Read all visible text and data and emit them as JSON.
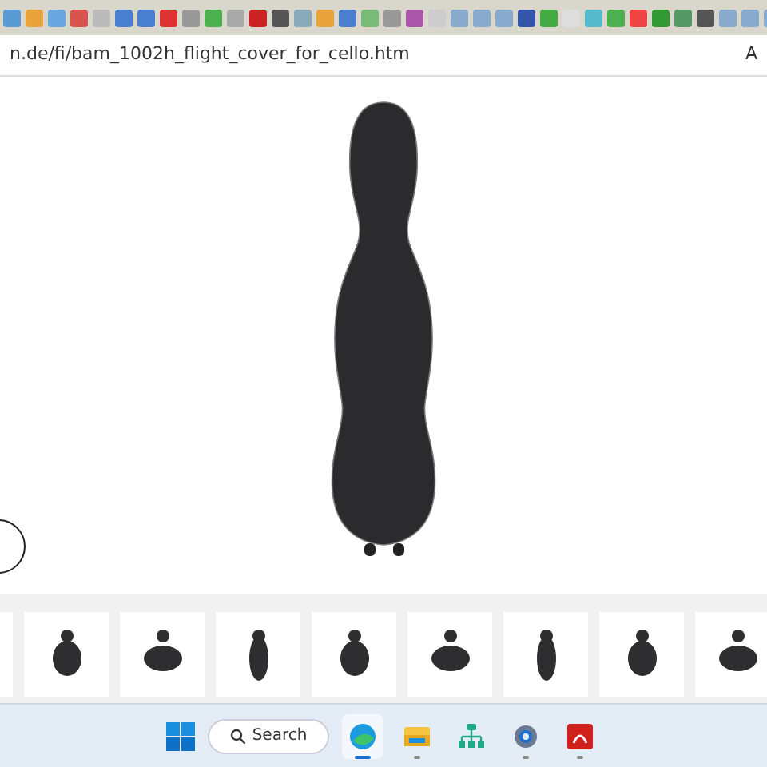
{
  "address_bar": {
    "url": "n.de/fi/bam_1002h_flight_cover_for_cello.htm",
    "trailing": "A"
  },
  "taskbar": {
    "search": {
      "placeholder": "Search"
    },
    "apps": [
      {
        "kind": "edge",
        "running": true,
        "selected": true
      },
      {
        "kind": "folder",
        "running": true,
        "selected": false
      },
      {
        "kind": "network",
        "running": false,
        "selected": false
      },
      {
        "kind": "gear",
        "running": true,
        "selected": false
      },
      {
        "kind": "pdf",
        "running": true,
        "selected": false
      }
    ]
  }
}
